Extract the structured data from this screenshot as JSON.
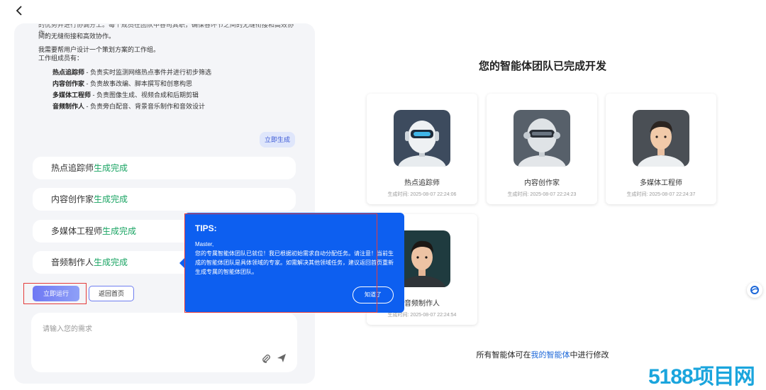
{
  "chat": {
    "intro_clipped": "的优势并进行协调分工。每个成员在团队中各司其职，确保各环节之间的无缝衔接和高效协作。",
    "intro_line2": "间的无缝衔接和高效协作。",
    "request": "我需要帮用户设计一个策划方案的工作组。",
    "members_label": "工作组成员有：",
    "members": [
      {
        "role": "热点追踪师",
        "desc": " - 负责实时监测网络热点事件并进行初步筛选"
      },
      {
        "role": "内容创作家",
        "desc": " - 负责故事改编、脚本撰写和创意构思"
      },
      {
        "role": "多媒体工程师",
        "desc": " - 负责图像生成、视频合成和后期剪辑"
      },
      {
        "role": "音频制作人",
        "desc": " - 负责旁白配音、背景音乐制作和音效设计"
      }
    ],
    "generate_label": "立即生成"
  },
  "statuses": [
    {
      "name": "热点追踪师",
      "state": "生成完成"
    },
    {
      "name": "内容创作家",
      "state": "生成完成"
    },
    {
      "name": "多媒体工程师",
      "state": "生成完成"
    },
    {
      "name": "音频制作人",
      "state": "生成完成"
    }
  ],
  "actions": {
    "run": "立即运行",
    "home": "返回首页"
  },
  "input": {
    "placeholder": "请输入您的需求"
  },
  "team": {
    "title": "您的智能体团队已完成开发",
    "agents": [
      {
        "name": "热点追踪师",
        "time": "生成时间: 2025-08-07 22:24:06"
      },
      {
        "name": "内容创作家",
        "time": "生成时间: 2025-08-07 22:24:23"
      },
      {
        "name": "多媒体工程师",
        "time": "生成时间: 2025-08-07 22:24:37"
      },
      {
        "name": "音频制作人",
        "time": "生成时间: 2025-08-07 22:24:54"
      }
    ],
    "footer_pre": "所有智能体可在",
    "footer_link": "我的智能体",
    "footer_post": "中进行修改"
  },
  "tips": {
    "title": "TIPS:",
    "greeting": "Master,",
    "message": "您的专属智能体团队已就位！我已根据初始需求自动分配任务。请注意！当前生成的智能体团队是具体领域的专家。如需解决其他领域任务，建议返回首页重新生成专属的智能体团队。",
    "ok": "知道了"
  },
  "watermark": "5188项目网",
  "colors": {
    "accent": "#0d5ff0",
    "success": "#19a463",
    "link": "#1c67d8",
    "highlight": "#e43b3b"
  }
}
